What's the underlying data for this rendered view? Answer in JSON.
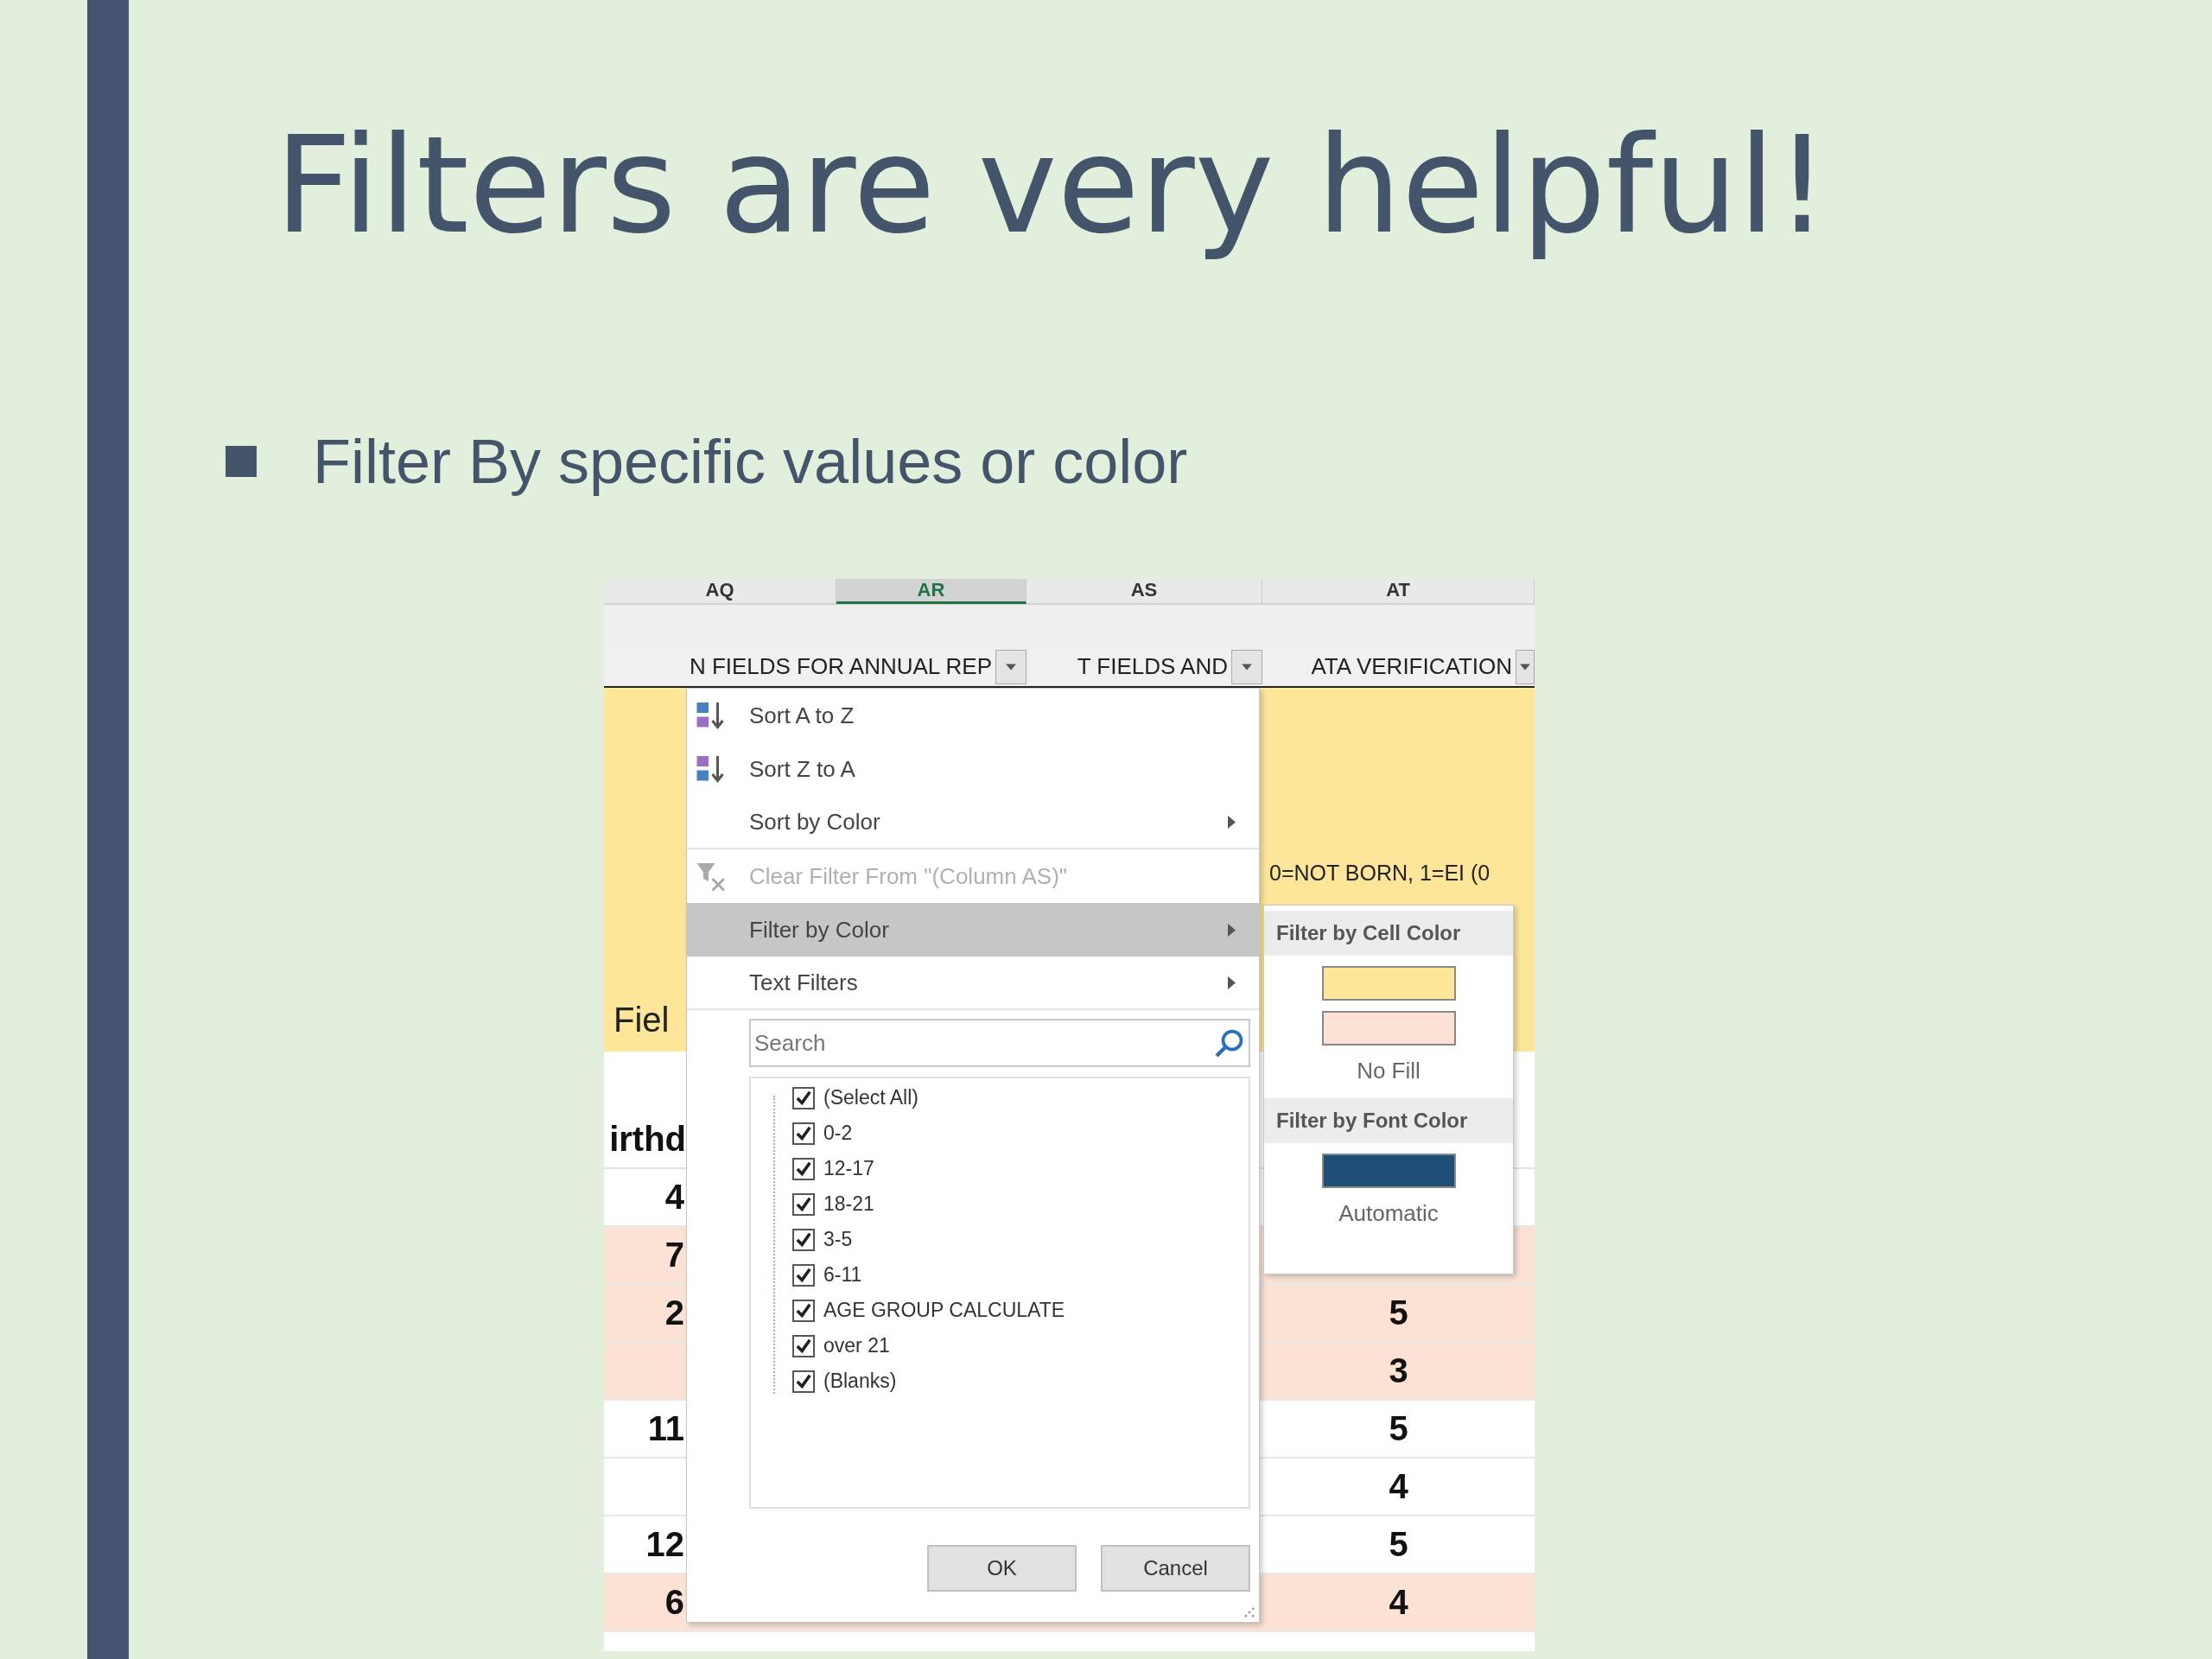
{
  "slide": {
    "title": "Filters are very helpful!",
    "bullets": [
      "Filter By specific values or color"
    ]
  },
  "sheet": {
    "columns": [
      {
        "label": "AQ",
        "selected": false
      },
      {
        "label": "AR",
        "selected": true
      },
      {
        "label": "AS",
        "selected": false
      },
      {
        "label": "AT",
        "selected": false
      }
    ],
    "filter_headers": [
      "N FIELDS FOR ANNUAL REP",
      "T FIELDS AND",
      "ATA VERIFICATION"
    ],
    "column_1_header": "Fiel",
    "column_4_header": "0=NOT BORN, 1=EI (0",
    "column_1_subheader": "irthd",
    "rows": [
      {
        "shaded": false,
        "column_1": "4"
      },
      {
        "shaded": true,
        "column_1": "7"
      },
      {
        "shaded": true,
        "column_1": "2",
        "column_4": "5"
      },
      {
        "shaded": true,
        "column_4": "3"
      },
      {
        "shaded": false,
        "column_1": "11",
        "column_4": "5"
      },
      {
        "shaded": false,
        "column_4": "4"
      },
      {
        "shaded": false,
        "column_1": "12",
        "column_4": "5"
      },
      {
        "shaded": true,
        "column_1": "6",
        "column_4": "4"
      }
    ]
  },
  "menu": {
    "items": [
      {
        "label": "Sort A to Z",
        "kind": "sort-ascending",
        "submenu": false,
        "disabled": false,
        "selected": false,
        "divider_below": false
      },
      {
        "label": "Sort Z to A",
        "kind": "sort-descending",
        "submenu": false,
        "disabled": false,
        "selected": false,
        "divider_below": false
      },
      {
        "label": "Sort by Color",
        "kind": "plain",
        "submenu": true,
        "disabled": false,
        "selected": false,
        "divider_below": true
      },
      {
        "label": "Clear Filter From \"(Column AS)\"",
        "kind": "clear-filter",
        "submenu": false,
        "disabled": true,
        "selected": false,
        "divider_below": false
      },
      {
        "label": "Filter by Color",
        "kind": "plain",
        "submenu": true,
        "disabled": false,
        "selected": true,
        "divider_below": false
      },
      {
        "label": "Text Filters",
        "kind": "plain",
        "submenu": true,
        "disabled": false,
        "selected": false,
        "divider_below": true
      }
    ],
    "search": {
      "placeholder": "Search"
    },
    "checklist": [
      {
        "label": "(Select All)",
        "checked": true
      },
      {
        "label": "0-2",
        "checked": true
      },
      {
        "label": "12-17",
        "checked": true
      },
      {
        "label": "18-21",
        "checked": true
      },
      {
        "label": "3-5",
        "checked": true
      },
      {
        "label": "6-11",
        "checked": true
      },
      {
        "label": "AGE GROUP CALCULATE",
        "checked": true
      },
      {
        "label": "over 21",
        "checked": true
      },
      {
        "label": "(Blanks)",
        "checked": true
      }
    ],
    "buttons": [
      "OK",
      "Cancel"
    ]
  },
  "submenu": {
    "sections": [
      {
        "title": "Filter by Cell Color",
        "swatches": [
          {
            "color": "#fde59a"
          },
          {
            "color": "#fbe2d5"
          }
        ],
        "option": "No Fill"
      },
      {
        "title": "Filter by Font Color",
        "swatches": [
          {
            "color": "#1f4e79"
          }
        ],
        "option": "Automatic"
      }
    ]
  }
}
